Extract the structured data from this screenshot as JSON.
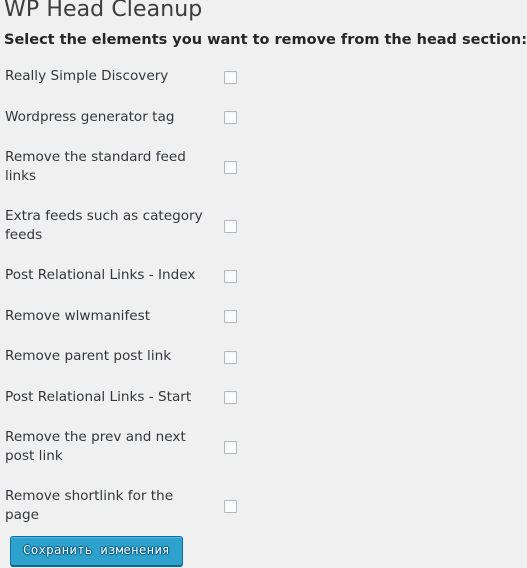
{
  "header": {
    "title": "WP Head Cleanup",
    "subtitle": "Select the elements you want to remove from the head section:"
  },
  "colors": {
    "page_background": "#f0f0f0",
    "title_text": "#3c3c3c",
    "label_text": "#32373c",
    "button_background": "#2ea2cc",
    "button_border": "#0074a2",
    "checkbox_border": "#b4b9be",
    "checkbox_fill": "#fcfcfc"
  },
  "options": [
    {
      "label": "Really Simple Discovery",
      "checked": false,
      "icon": "checkbox-unchecked-icon"
    },
    {
      "label": "Wordpress generator tag",
      "checked": false,
      "icon": "checkbox-unchecked-icon"
    },
    {
      "label": "Remove the standard feed links",
      "checked": false,
      "icon": "checkbox-unchecked-icon"
    },
    {
      "label": "Extra feeds such as category feeds",
      "checked": false,
      "icon": "checkbox-unchecked-icon"
    },
    {
      "label": "Post Relational Links - Index",
      "checked": false,
      "icon": "checkbox-unchecked-icon"
    },
    {
      "label": "Remove wlwmanifest",
      "checked": false,
      "icon": "checkbox-unchecked-icon"
    },
    {
      "label": "Remove parent post link",
      "checked": false,
      "icon": "checkbox-unchecked-icon"
    },
    {
      "label": "Post Relational Links - Start",
      "checked": false,
      "icon": "checkbox-unchecked-icon"
    },
    {
      "label": "Remove the prev and next post link",
      "checked": false,
      "icon": "checkbox-unchecked-icon"
    },
    {
      "label": "Remove shortlink for the page",
      "checked": false,
      "icon": "checkbox-unchecked-icon"
    }
  ],
  "footer": {
    "submit_label": "Сохранить изменения"
  }
}
